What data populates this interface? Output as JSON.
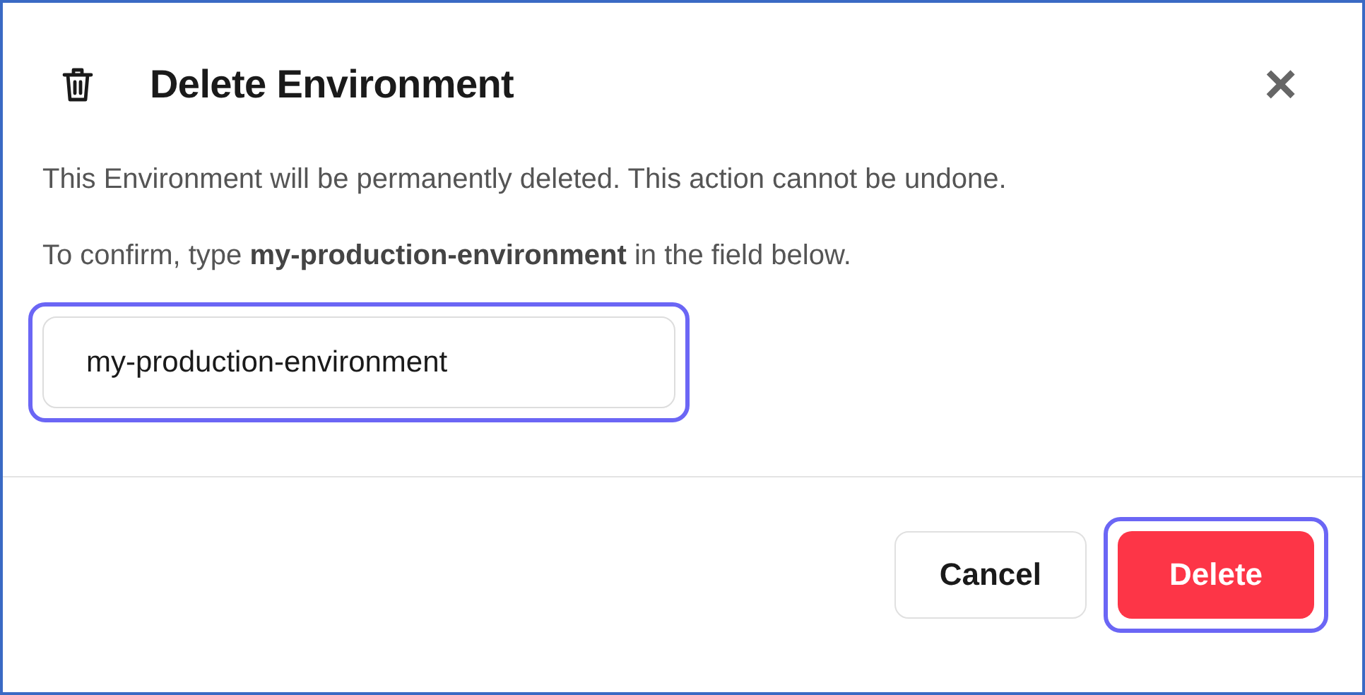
{
  "dialog": {
    "title": "Delete Environment",
    "close": "×"
  },
  "body": {
    "warning": "This Environment will be permanently deleted. This action cannot be undone.",
    "instruction": "To confirm, type **my-production-environment** in the field below."
  },
  "field": {
    "value": "my-production-environment",
    "focused": true
  },
  "buttons": [
    {
      "label": "Cancel",
      "kind": "secondary",
      "focused": false
    },
    {
      "label": "Delete",
      "kind": "danger",
      "focused": true
    }
  ]
}
